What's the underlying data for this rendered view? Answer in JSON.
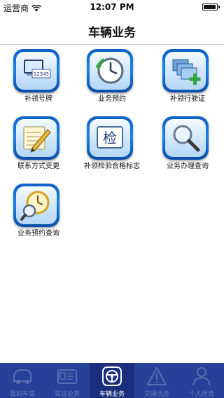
{
  "status_bar": {
    "carrier": "运营商",
    "time": "12:07 PM",
    "battery_level": 0.95
  },
  "nav": {
    "title": "车辆业务"
  },
  "tiles": [
    {
      "label": "补领号牌",
      "icon": "license-plate-icon"
    },
    {
      "label": "业务预约",
      "icon": "clock-icon"
    },
    {
      "label": "补领行驶证",
      "icon": "add-document-icon"
    },
    {
      "label": "联系方式变更",
      "icon": "edit-note-icon"
    },
    {
      "label": "补领检验合格标志",
      "icon": "inspection-mark-icon",
      "icon_text": "检"
    },
    {
      "label": "业务办理查询",
      "icon": "magnifier-icon"
    },
    {
      "label": "业务预约查询",
      "icon": "clock-search-icon"
    }
  ],
  "tabs": [
    {
      "label": "我的车驾",
      "icon": "car-icon",
      "active": false
    },
    {
      "label": "驾证业务",
      "icon": "license-card-icon",
      "active": false
    },
    {
      "label": "车辆业务",
      "icon": "steering-wheel-icon",
      "active": true
    },
    {
      "label": "交通信息",
      "icon": "warning-sign-icon",
      "active": false
    },
    {
      "label": "个人信息",
      "icon": "person-icon",
      "active": false
    }
  ],
  "colors": {
    "tab_bar": "#27409a",
    "tab_active": "#1a2e7c",
    "icon_frame": "#1b86e8"
  }
}
